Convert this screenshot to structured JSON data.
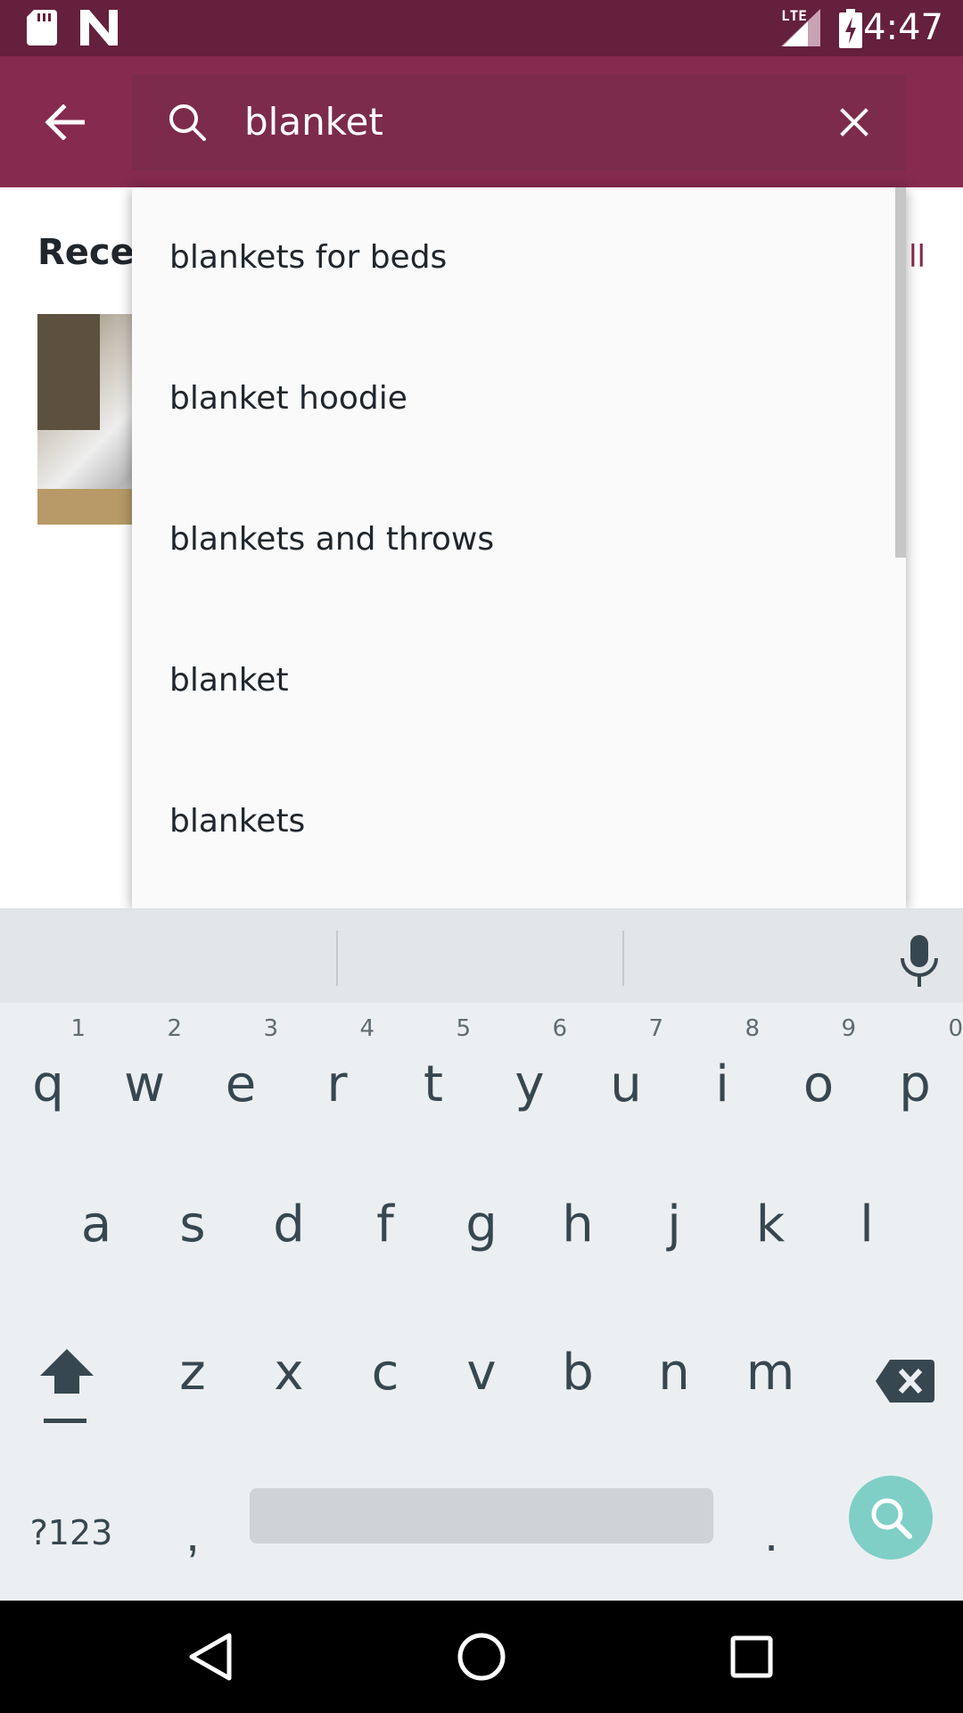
{
  "status_bar": {
    "time": "4:47",
    "network_label": "LTE",
    "icons": [
      "sd-card-icon",
      "n-logo-icon",
      "lte-signal-icon",
      "battery-charging-icon"
    ]
  },
  "search": {
    "value": "blanket",
    "back_icon": "arrow-left-icon",
    "search_icon": "search-icon",
    "clear_icon": "close-icon"
  },
  "recent": {
    "title_visible": "Recen",
    "see_all_visible": "ll"
  },
  "suggestions": [
    {
      "label": "blankets for beds"
    },
    {
      "label": "blanket hoodie"
    },
    {
      "label": "blankets and throws"
    },
    {
      "label": "blanket"
    },
    {
      "label": "blankets"
    }
  ],
  "keyboard": {
    "row1": [
      {
        "ch": "q",
        "num": "1"
      },
      {
        "ch": "w",
        "num": "2"
      },
      {
        "ch": "e",
        "num": "3"
      },
      {
        "ch": "r",
        "num": "4"
      },
      {
        "ch": "t",
        "num": "5"
      },
      {
        "ch": "y",
        "num": "6"
      },
      {
        "ch": "u",
        "num": "7"
      },
      {
        "ch": "i",
        "num": "8"
      },
      {
        "ch": "o",
        "num": "9"
      },
      {
        "ch": "p",
        "num": "0"
      }
    ],
    "row2": [
      "a",
      "s",
      "d",
      "f",
      "g",
      "h",
      "j",
      "k",
      "l"
    ],
    "row3": [
      "z",
      "x",
      "c",
      "v",
      "b",
      "n",
      "m"
    ],
    "symbols_label": "?123",
    "comma_label": ",",
    "period_label": ".",
    "accent_color": "#7fcfc7"
  },
  "colors": {
    "status_bar": "#65203d",
    "app_bar": "#862a4f",
    "search_box": "#7c2b4b"
  }
}
